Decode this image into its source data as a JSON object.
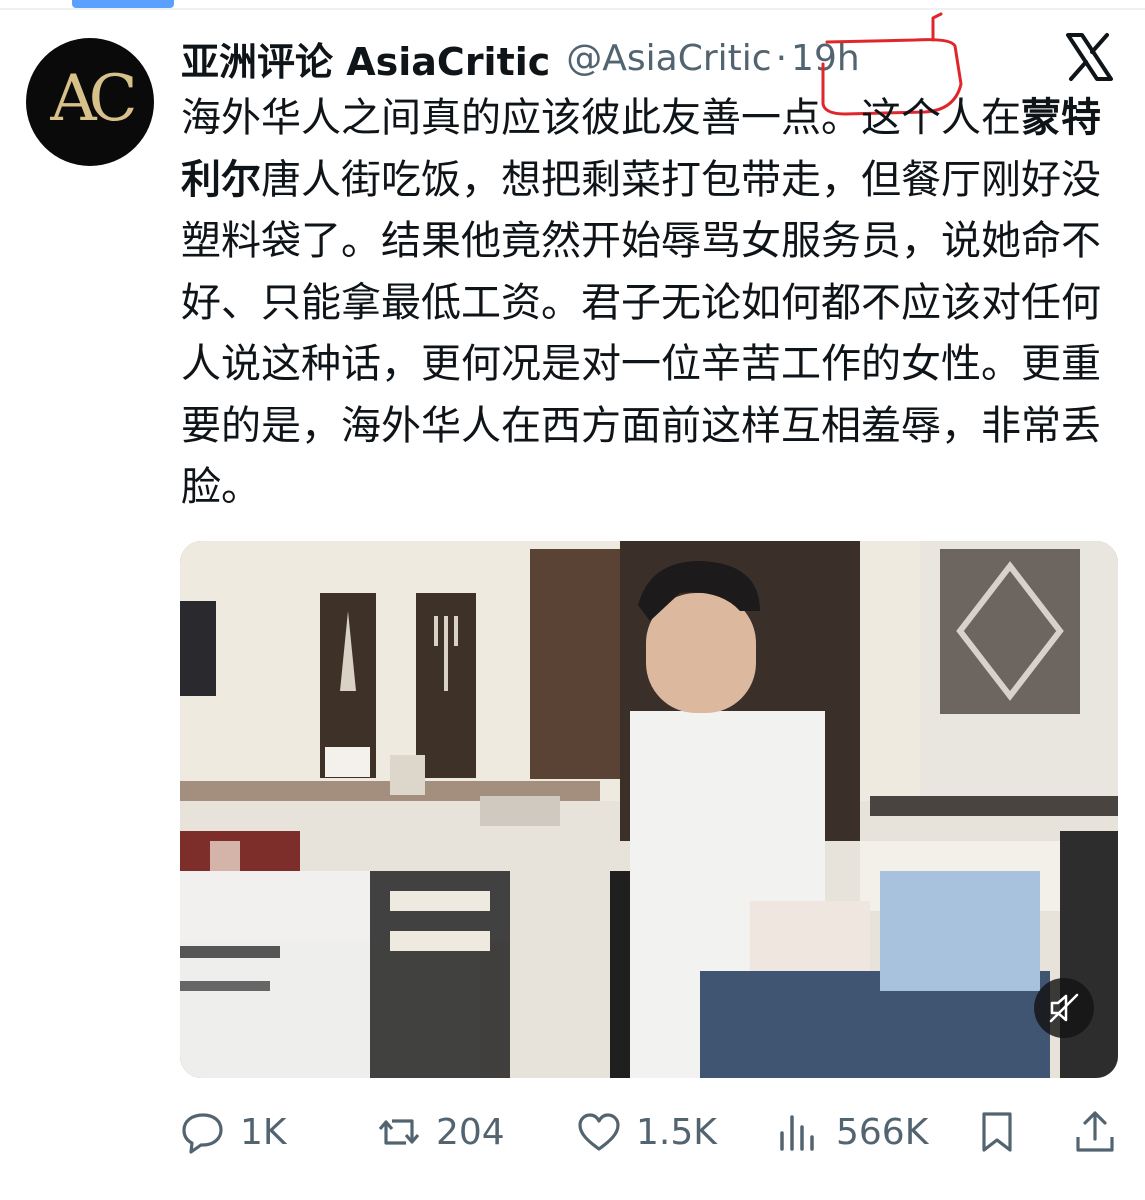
{
  "tweet": {
    "author": {
      "display_name": "亚洲评论 AsiaCritic",
      "handle": "@AsiaCritic",
      "avatar_text": "AC"
    },
    "separator": "·",
    "time": "19h",
    "text_bold": "蒙特利尔",
    "text_before": "海外华人之间真的应该彼此友善一点。这个人在",
    "text_after": "唐人街吃饭，想把剩菜打包带走，但餐厅刚好没塑料袋了。结果他竟然开始辱骂女服务员，说她命不好、只能拿最低工资。君子无论如何都不应该对任何人说这种话，更何况是对一位辛苦工作的女性。更重要的是，海外华人在西方面前这样互相羞辱，非常丢脸。",
    "media": {
      "type": "video",
      "muted_icon": "speaker-muted-icon"
    },
    "stats": {
      "replies": "1K",
      "reposts": "204",
      "likes": "1.5K",
      "views": "566K"
    }
  },
  "colors": {
    "text_primary": "#0f1419",
    "text_secondary": "#536471",
    "annotation": "#e0262b",
    "scroll_indicator": "#5aa0ff"
  }
}
